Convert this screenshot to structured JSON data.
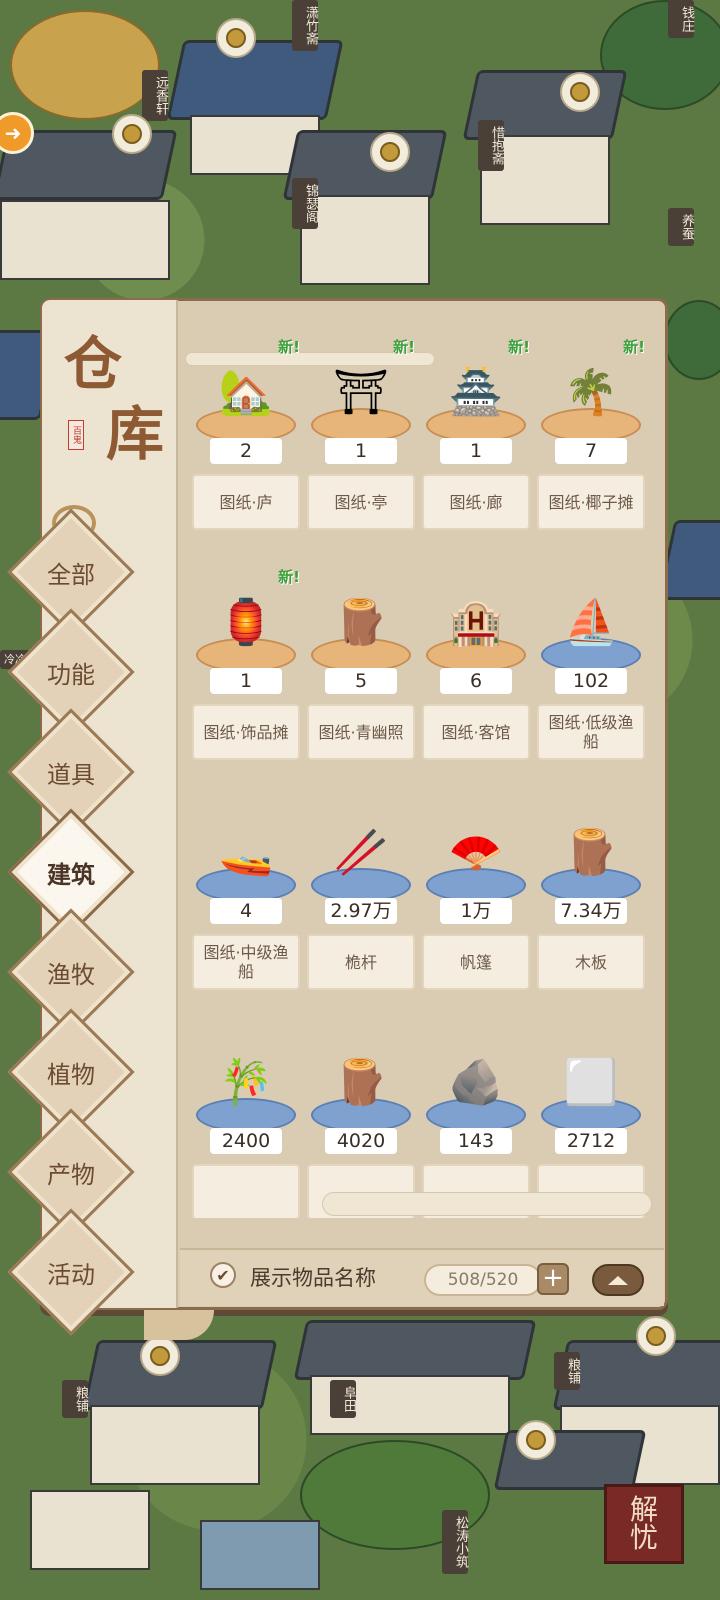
{
  "background": {
    "shop_signs": [
      "潇竹斋",
      "远香轩",
      "锦瑟阁",
      "惜抱斋",
      "钱庄",
      "养蚕",
      "粮铺",
      "阜田",
      "粮铺",
      "松涛小筑",
      "冷冷"
    ]
  },
  "warehouse": {
    "title_1": "仓",
    "title_2": "库",
    "seal": "百鬼",
    "tabs": [
      {
        "label": "全部",
        "active": false
      },
      {
        "label": "功能",
        "active": false
      },
      {
        "label": "道具",
        "active": false
      },
      {
        "label": "建筑",
        "active": true
      },
      {
        "label": "渔牧",
        "active": false
      },
      {
        "label": "植物",
        "active": false
      },
      {
        "label": "产物",
        "active": false
      },
      {
        "label": "活动",
        "active": false
      }
    ],
    "new_badge": "新!",
    "items": [
      {
        "icon": "hut-blueprint-icon",
        "count": "2",
        "name": "图纸·庐",
        "is_new": true,
        "pedestal": "orange"
      },
      {
        "icon": "pavilion-blueprint-icon",
        "count": "1",
        "name": "图纸·亭",
        "is_new": true,
        "pedestal": "orange"
      },
      {
        "icon": "corridor-blueprint-icon",
        "count": "1",
        "name": "图纸·廊",
        "is_new": true,
        "pedestal": "orange"
      },
      {
        "icon": "coconut-stall-blueprint-icon",
        "count": "7",
        "name": "图纸·椰子摊",
        "is_new": true,
        "pedestal": "orange"
      },
      {
        "icon": "ornament-stall-blueprint-icon",
        "count": "1",
        "name": "图纸·饰品摊",
        "is_new": true,
        "pedestal": "orange"
      },
      {
        "icon": "wooden-plaque-icon",
        "count": "5",
        "name": "图纸·青幽照",
        "is_new": false,
        "pedestal": "orange"
      },
      {
        "icon": "inn-blueprint-icon",
        "count": "6",
        "name": "图纸·客馆",
        "is_new": false,
        "pedestal": "orange"
      },
      {
        "icon": "low-fishing-boat-blueprint-icon",
        "count": "102",
        "name": "图纸·低级渔船",
        "is_new": false,
        "pedestal": "blue"
      },
      {
        "icon": "mid-fishing-boat-blueprint-icon",
        "count": "4",
        "name": "图纸·中级渔船",
        "is_new": false,
        "pedestal": "blue"
      },
      {
        "icon": "mast-icon",
        "count": "2.97万",
        "name": "桅杆",
        "is_new": false,
        "pedestal": "blue"
      },
      {
        "icon": "sail-icon",
        "count": "1万",
        "name": "帆篷",
        "is_new": false,
        "pedestal": "blue"
      },
      {
        "icon": "wood-plank-icon",
        "count": "7.34万",
        "name": "木板",
        "is_new": false,
        "pedestal": "blue"
      },
      {
        "icon": "bamboo-icon",
        "count": "2400",
        "name": "",
        "is_new": false,
        "pedestal": "blue"
      },
      {
        "icon": "log-icon",
        "count": "4020",
        "name": "",
        "is_new": false,
        "pedestal": "blue"
      },
      {
        "icon": "ore-icon",
        "count": "143",
        "name": "",
        "is_new": false,
        "pedestal": "blue"
      },
      {
        "icon": "stone-block-icon",
        "count": "2712",
        "name": "",
        "is_new": false,
        "pedestal": "blue"
      }
    ],
    "show_names_label": "展示物品名称",
    "show_names_checked": true,
    "capacity": "508/520",
    "plus_label": "+"
  },
  "stamp": {
    "line1": "解",
    "line2": "忧"
  }
}
